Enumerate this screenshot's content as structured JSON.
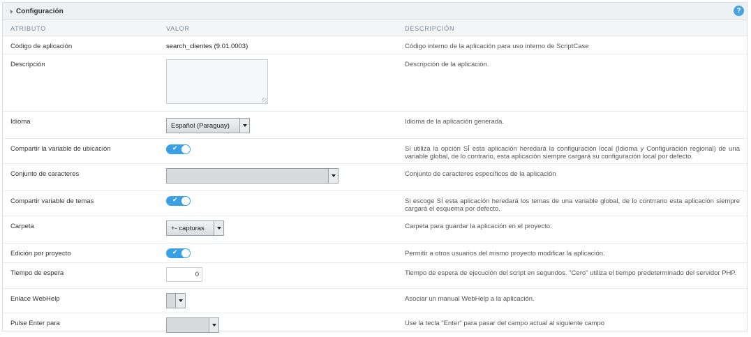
{
  "panel": {
    "title": "Configuración",
    "help_label": "?"
  },
  "columns": {
    "attribute": "ATRIBUTO",
    "value": "VALOR",
    "description": "DESCRIPCIÓN"
  },
  "rows": [
    {
      "attribute": "Código de aplicación",
      "value": "search_clientes (9.01.0003)",
      "description": "Código interno de la aplicación para uso interno de ScriptCase"
    },
    {
      "attribute": "Descripción",
      "value": "",
      "description": "Descripción de la aplicación."
    },
    {
      "attribute": "Idioma",
      "value": "Español (Paraguay)",
      "description": "Idioma de la aplicación generada."
    },
    {
      "attribute": "Compartir la variable de ubicación",
      "value": "Sí",
      "description": "Si utiliza la opción SÍ esta aplicación heredará la configuración local (Idioma y Configuración regional) de una variable global, de lo contrario, esta aplicación siempre cargará su configuración local por defecto."
    },
    {
      "attribute": "Conjunto de caracteres",
      "value": "",
      "description": "Conjunto de caracteres específicos de la aplicación"
    },
    {
      "attribute": "Compartir variable de temas",
      "value": "Sí",
      "description": "Si escoge SÍ esta aplicación heredará los temas de una variable global, de lo contrrario esta aplicación siempre cargará el esquema por defecto."
    },
    {
      "attribute": "Carpeta",
      "value": "+- capturas",
      "description": "Carpeta para guardar la aplicación en el proyecto."
    },
    {
      "attribute": "Edición por proyecto",
      "value": "Sí",
      "description": "Permitir a otros usuarios del mismo proyecto modificar la aplicación."
    },
    {
      "attribute": "Tiempo de espera",
      "value": "0",
      "description": "Tiempo de espera de ejecución del script en segundos. \"Cero\" utiliza el tiempo predeterminado del servidor PHP."
    },
    {
      "attribute": "Enlace WebHelp",
      "value": "",
      "description": "Asociar un manual WebHelp a la aplicación."
    },
    {
      "attribute": "Pulse Enter para",
      "value": "",
      "description": "Use la tecla \"Enter\" para pasar del campo actual al siguiente campo"
    }
  ],
  "colors": {
    "accent": "#3aa0e6",
    "header_bg": "#eef1f4",
    "help": "#4aa3df"
  }
}
